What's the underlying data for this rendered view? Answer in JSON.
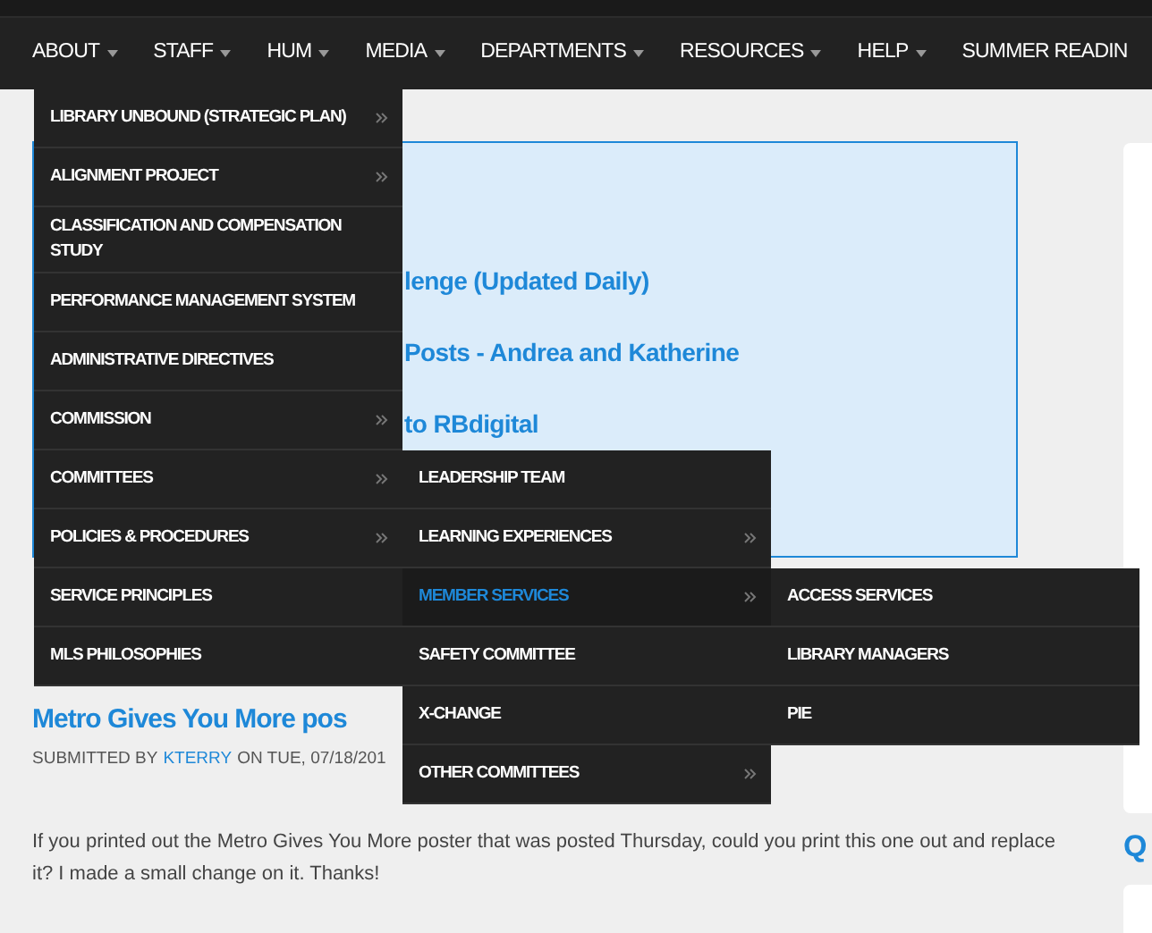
{
  "nav": {
    "items": [
      {
        "label": "ABOUT",
        "caret": true
      },
      {
        "label": "STAFF",
        "caret": true
      },
      {
        "label": "HUM",
        "caret": true
      },
      {
        "label": "MEDIA",
        "caret": true
      },
      {
        "label": "DEPARTMENTS",
        "caret": true
      },
      {
        "label": "RESOURCES",
        "caret": true
      },
      {
        "label": "HELP",
        "caret": true
      },
      {
        "label": "SUMMER READIN",
        "caret": false
      }
    ]
  },
  "menu": {
    "items": [
      {
        "label": "LIBRARY UNBOUND (STRATEGIC PLAN)",
        "submenu": true,
        "selected": false
      },
      {
        "label": "ALIGNMENT PROJECT",
        "submenu": true,
        "selected": false
      },
      {
        "label": "CLASSIFICATION AND COMPENSATION STUDY",
        "submenu": false,
        "selected": false
      },
      {
        "label": "PERFORMANCE MANAGEMENT SYSTEM",
        "submenu": false,
        "selected": false
      },
      {
        "label": "ADMINISTRATIVE DIRECTIVES",
        "submenu": false,
        "selected": false
      },
      {
        "label": "COMMISSION",
        "submenu": true,
        "selected": false
      },
      {
        "label": "COMMITTEES",
        "submenu": true,
        "selected": false,
        "children": [
          {
            "label": "LEADERSHIP TEAM",
            "submenu": false,
            "selected": false
          },
          {
            "label": "LEARNING EXPERIENCES",
            "submenu": true,
            "selected": false
          },
          {
            "label": "MEMBER SERVICES",
            "submenu": true,
            "selected": true,
            "children": [
              {
                "label": "ACCESS SERVICES",
                "submenu": false,
                "selected": false
              },
              {
                "label": "LIBRARY MANAGERS",
                "submenu": false,
                "selected": false
              },
              {
                "label": "PIE",
                "submenu": false,
                "selected": false
              }
            ]
          },
          {
            "label": "SAFETY COMMITTEE",
            "submenu": false,
            "selected": false
          },
          {
            "label": "X-CHANGE",
            "submenu": false,
            "selected": false
          },
          {
            "label": "OTHER COMMITTEES",
            "submenu": true,
            "selected": false
          }
        ]
      },
      {
        "label": "POLICIES & PROCEDURES",
        "submenu": true,
        "selected": false
      },
      {
        "label": "SERVICE PRINCIPLES",
        "submenu": false,
        "selected": false
      },
      {
        "label": "MLS PHILOSOPHIES",
        "submenu": false,
        "selected": false
      }
    ]
  },
  "highlights": {
    "links": [
      "lenge (Updated Daily)",
      "Posts - Andrea and Katherine",
      "to RBdigital"
    ]
  },
  "post": {
    "title": "Metro Gives You More pos",
    "submitted_by": "SUBMITTED BY",
    "author": "KTERRY",
    "date": "ON TUE, 07/18/201",
    "body": "If you printed out the Metro Gives You More poster that was posted Thursday, could you print this one out and replace it? I made a small change on it.  Thanks!"
  },
  "sidebar": {
    "heading": "Q"
  }
}
